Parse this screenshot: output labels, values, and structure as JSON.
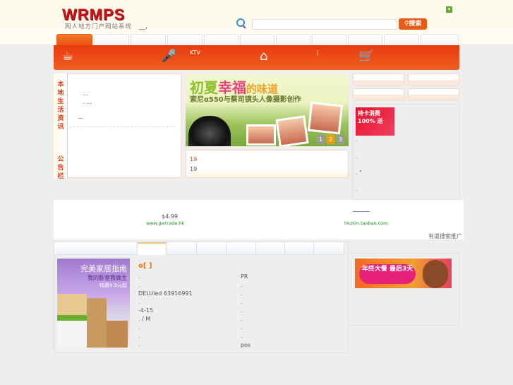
{
  "header": {
    "logo": "WRMPS",
    "logo_sub": "网人地方门户网站系统",
    "tagline": "__,",
    "search_placeholder": "",
    "search_button": "搜索"
  },
  "nav": {
    "tabs": [
      "",
      "",
      "",
      "",
      "",
      "",
      "",
      "",
      "",
      "",
      ""
    ],
    "items": [
      {
        "icon": "coffee-cup-icon",
        "label": ""
      },
      {
        "icon": "microphone-icon",
        "label": "KTV"
      },
      {
        "icon": "house-icon",
        "label": "|"
      },
      {
        "icon": "shopping-cart-icon",
        "label": ""
      }
    ]
  },
  "left_panel": {
    "label_top": "本地生活资讯",
    "label_bottom": "公告栏",
    "lines": [
      "...",
      ". ...",
      "—"
    ]
  },
  "banner": {
    "title_a": "初夏",
    "title_b": "幸福",
    "title_c": "的味道",
    "subtitle": "索尼α550与蔡司镜头人像摄影创作",
    "pages": [
      "1",
      "2",
      "3"
    ],
    "active_page": 2
  },
  "notice": {
    "lines": [
      "19",
      "19"
    ]
  },
  "right_panel": {
    "ad_text": "持卡消费 100% 送",
    "dots": [
      ".",
      ".",
      ". \"",
      "."
    ]
  },
  "ad_strip": {
    "left_price": "$4.99",
    "left_url": "www.gwtrade.hk",
    "right_url": "hkzkin.taobao.com",
    "footer": "有道搜索推广"
  },
  "bottom": {
    "tabs": [
      "",
      "",
      "",
      "",
      "",
      "",
      "",
      ""
    ],
    "active_tab": 1,
    "pic_t1": "完美家居指南",
    "pic_t2": "我的卧室我做主",
    "pic_t3": "特惠9.9元起",
    "title": "o[    ]",
    "col1": [
      ".",
      ".",
      "DELUled  63916991",
      ".",
      "  -4-15",
      ". /      M",
      ".",
      ".",
      "."
    ],
    "col2": [
      "PR",
      ".",
      ".",
      ".",
      ".",
      ".",
      ".",
      ".",
      "pos"
    ],
    "ad_text": "年终大餐 最后3天"
  },
  "colors": {
    "accent": "#ea5a12",
    "nav": "#e8390e",
    "logo": "#c8141a"
  }
}
